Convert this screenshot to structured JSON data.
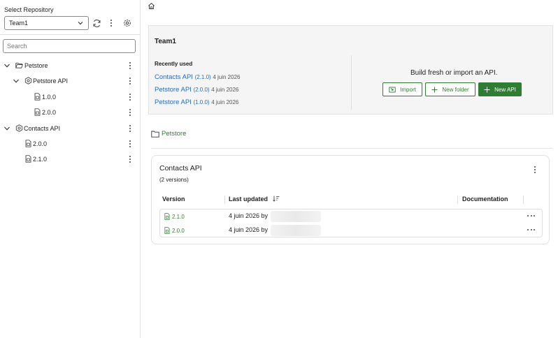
{
  "sidebar": {
    "select_label": "Select Repository",
    "selected_repo": "Team1",
    "search_placeholder": "Search",
    "tree": [
      {
        "label": "Petstore",
        "type": "folder",
        "expanded": true
      },
      {
        "label": "Petstore API",
        "type": "api",
        "expanded": true
      },
      {
        "label": "1.0.0",
        "type": "version"
      },
      {
        "label": "2.0.0",
        "type": "version"
      },
      {
        "label": "Contacts API",
        "type": "api",
        "expanded": true
      },
      {
        "label": "2.0.0",
        "type": "version"
      },
      {
        "label": "2.1.0",
        "type": "version"
      }
    ]
  },
  "overview": {
    "team_title": "Team1",
    "recently_used_heading": "Recently used",
    "recent": [
      {
        "name": "Contacts API",
        "version": "(2.1.0)",
        "date": "4 juin 2026"
      },
      {
        "name": "Petstore API",
        "version": "(2.0.0)",
        "date": "4 juin 2026"
      },
      {
        "name": "Petstore API",
        "version": "(1.0.0)",
        "date": "4 juin 2026"
      }
    ],
    "build_text": "Build fresh or import an API.",
    "import_label": "Import",
    "new_folder_label": "New folder",
    "new_api_label": "New API"
  },
  "folder_crumb": "Petstore",
  "api_card": {
    "title": "Contacts API",
    "subtitle": "(2 versions)",
    "columns": {
      "version": "Version",
      "last_updated": "Last updated",
      "documentation": "Documentation"
    },
    "rows": [
      {
        "version": "2.1.0",
        "updated": "4 juin 2026 by"
      },
      {
        "version": "2.0.0",
        "updated": "4 juin 2026 by"
      }
    ]
  },
  "colors": {
    "accent": "#2e7d32",
    "link": "#2b6cb8"
  }
}
